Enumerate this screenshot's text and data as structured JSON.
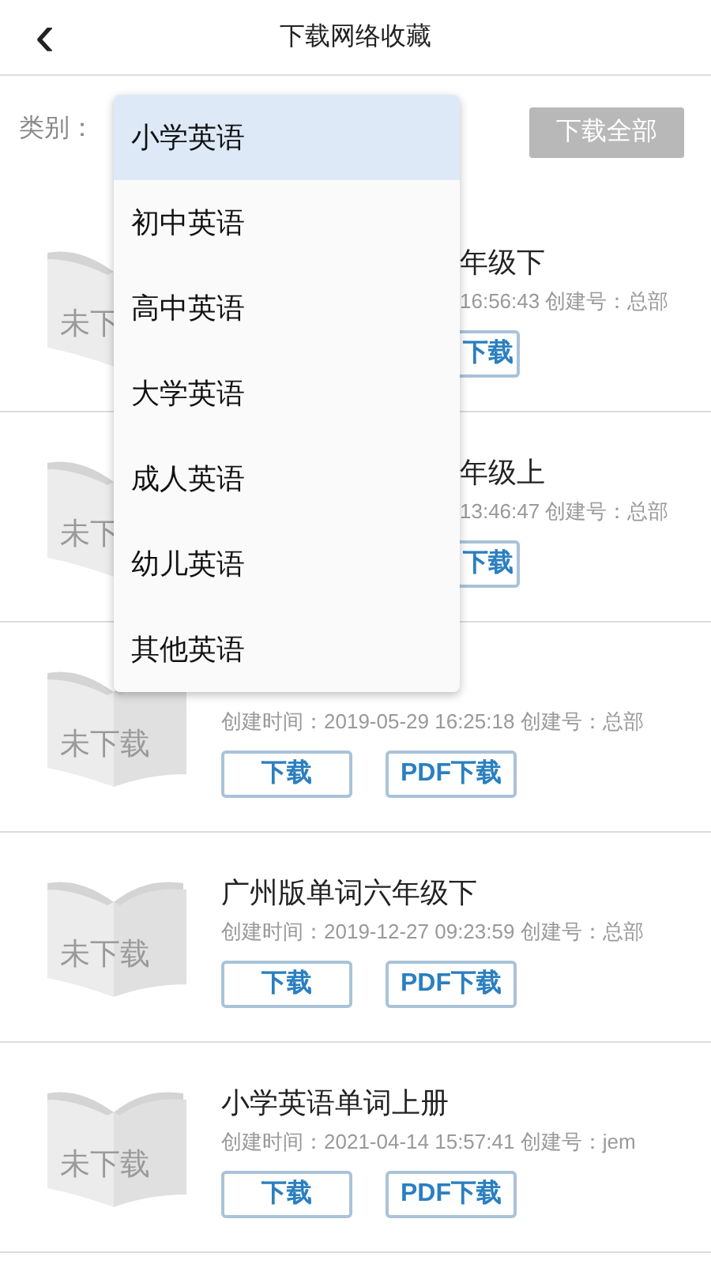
{
  "header": {
    "back": "‹",
    "title": "下载网络收藏"
  },
  "filter": {
    "label": "类别：",
    "download_all": {
      "label": "下载全部",
      "disabled": true
    }
  },
  "items": [
    {
      "kind": "partial",
      "status": "未下",
      "title": "年级下",
      "meta": "16:56:43 创建号：总部",
      "buttons": [
        "下载"
      ]
    },
    {
      "kind": "partial",
      "status": "未下",
      "title": "年级上",
      "meta": "13:46:47 创建号：总部",
      "buttons": [
        "下载"
      ]
    },
    {
      "kind": "full",
      "status": "未下载",
      "meta": "创建时间：2019-05-29 16:25:18 创建号：总部",
      "buttons": [
        "下载",
        "PDF下载"
      ]
    },
    {
      "kind": "full",
      "status": "未下载",
      "title": "广州版单词六年级下",
      "meta": "创建时间：2019-12-27 09:23:59 创建号：总部",
      "buttons": [
        "下载",
        "PDF下载"
      ]
    },
    {
      "kind": "full",
      "status": "未下载",
      "title": "小学英语单词上册",
      "meta": "创建时间：2021-04-14 15:57:41 创建号：jem",
      "buttons": [
        "下载",
        "PDF下载"
      ]
    }
  ],
  "menu": [
    {
      "label": "小学英语",
      "selected": true
    },
    {
      "label": "初中英语",
      "selected": false
    },
    {
      "label": "高中英语",
      "selected": false
    },
    {
      "label": "大学英语",
      "selected": false
    },
    {
      "label": "成人英语",
      "selected": false
    },
    {
      "label": "幼儿英语",
      "selected": false
    },
    {
      "label": "其他英语",
      "selected": false
    }
  ]
}
